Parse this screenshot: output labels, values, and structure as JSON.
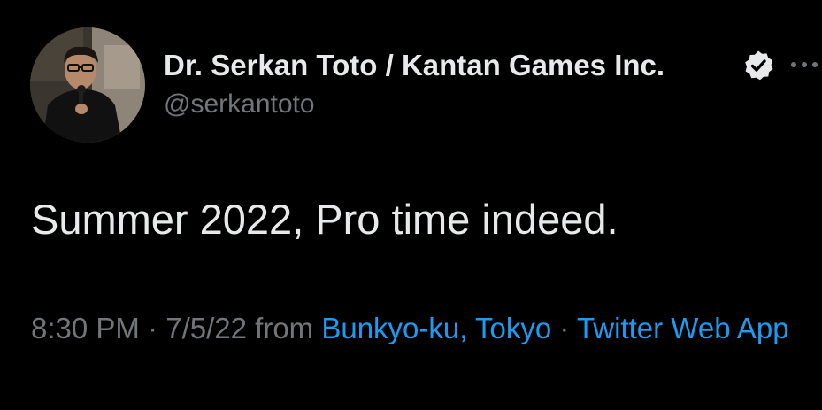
{
  "author": {
    "display_name": "Dr. Serkan Toto / Kantan Games Inc.",
    "handle": "@serkantoto",
    "verified": true
  },
  "tweet": {
    "text": "Summer 2022, Pro time indeed.",
    "time": "8:30 PM",
    "separator": "·",
    "date": "7/5/22",
    "from_label": "from",
    "location": "Bunkyo-ku, Tokyo",
    "source": "Twitter Web App"
  },
  "icons": {
    "verified": "verified-badge-icon",
    "more": "more-options-icon",
    "avatar": "profile-photo"
  },
  "colors": {
    "background": "#000000",
    "primary_text": "#e7e9ea",
    "secondary_text": "#71767b",
    "link": "#1d9bf0"
  }
}
